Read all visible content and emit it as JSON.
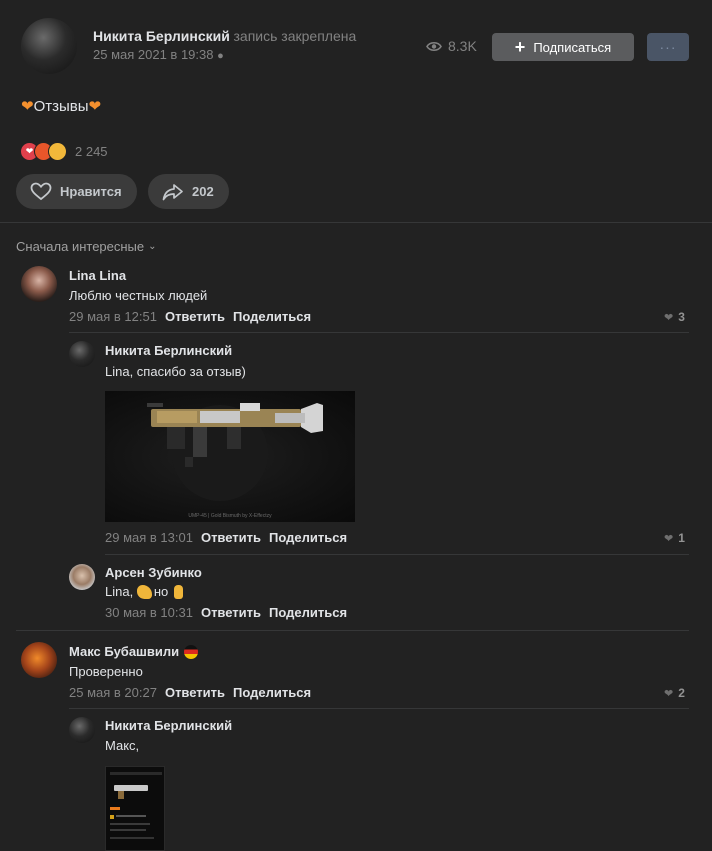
{
  "post": {
    "author": "Никита Берлинский",
    "pinned_label": "запись закреплена",
    "date": "25 мая 2021 в 19:38",
    "views": "8.3K",
    "subscribe_label": "Подписаться",
    "more_label": "···",
    "text": "Отзывы",
    "reactions_count": "2 245",
    "like_label": "Нравится",
    "share_count": "202"
  },
  "comments": {
    "sort_label": "Сначала интересные",
    "reply_label": "Ответить",
    "share_label": "Поделиться",
    "items": [
      {
        "author": "Lina Lina",
        "text": "Люблю честных людей",
        "date": "29 мая в 12:51",
        "likes": "3"
      },
      {
        "author": "Никита Берлинский",
        "text": "Lina, спасибо за отзыв)",
        "date": "29 мая в 13:01",
        "likes": "1",
        "image_caption": "UMP-45 | Gold Bismuth by X-Effectzy"
      },
      {
        "author": "Арсен Зубинко",
        "text_prefix": "Lina, ",
        "text_mid": "но",
        "date": "30 мая в 10:31"
      },
      {
        "author": "Макс Бубашвили",
        "text": "Проверенно",
        "date": "25 мая в 20:27",
        "likes": "2"
      },
      {
        "author": "Никита Берлинский",
        "text": "Макс,"
      }
    ]
  }
}
